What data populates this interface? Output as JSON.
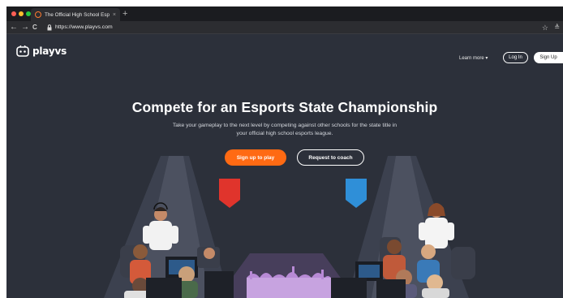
{
  "browser": {
    "tab_title": "The Official High School Espo",
    "tab_close": "×",
    "new_tab": "+",
    "back": "←",
    "forward": "→",
    "reload": "C",
    "url": "https://www.playvs.com",
    "star": "☆",
    "extension": "≜"
  },
  "nav": {
    "logo_text": "playvs",
    "learn_more": "Learn more ▾",
    "log_in": "Log In",
    "sign_up": "Sign Up"
  },
  "hero": {
    "headline": "Compete for an Esports State Championship",
    "subtext": "Take your gameplay to the next level by competing against other schools for the state title in your official high school esports league.",
    "primary_cta": "Sign up to play",
    "secondary_cta": "Request to coach"
  },
  "icons": {
    "favicon": "playvs-favicon-icon",
    "lock": "lock-icon",
    "logo": "playvs-logo-icon"
  },
  "colors": {
    "accent": "#ff6a13",
    "background": "#2c303a",
    "red_banner": "#e0342c",
    "blue_banner": "#2f8fd8"
  }
}
